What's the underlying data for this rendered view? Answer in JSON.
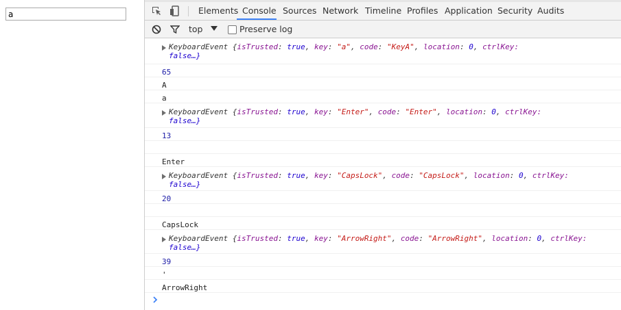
{
  "page": {
    "input_value": "a"
  },
  "tabs": [
    "Elements",
    "Console",
    "Sources",
    "Network",
    "Timeline",
    "Profiles",
    "Application",
    "Security",
    "Audits"
  ],
  "active_tab": "Console",
  "toolbar": {
    "context": "top",
    "preserve_log": "Preserve log"
  },
  "console": {
    "ev1": {
      "name": "KeyboardEvent",
      "isTrusted": "true",
      "key": "\"a\"",
      "code": "\"KeyA\"",
      "location": "0",
      "ctrl": "ctrlKey:",
      "tail": "false…}"
    },
    "v1": "65",
    "v2": "A",
    "v3": "a",
    "ev2": {
      "name": "KeyboardEvent",
      "isTrusted": "true",
      "key": "\"Enter\"",
      "code": "\"Enter\"",
      "location": "0",
      "ctrl": "ctrlKey:",
      "tail": "false…}"
    },
    "v4": "13",
    "v5": "",
    "v6": "Enter",
    "ev3": {
      "name": "KeyboardEvent",
      "isTrusted": "true",
      "key": "\"CapsLock\"",
      "code": "\"CapsLock\"",
      "location": "0",
      "ctrl": "ctrlKey:",
      "tail": "false…}"
    },
    "v7": "20",
    "v8": "",
    "v9": "CapsLock",
    "ev4": {
      "name": "KeyboardEvent",
      "isTrusted": "true",
      "key": "\"ArrowRight\"",
      "code": "\"ArrowRight\"",
      "location": "0",
      "ctrl": "ctrlKey:",
      "tail": "false…}"
    },
    "v10": "39",
    "v11": "'",
    "v12": "ArrowRight"
  },
  "colors": {
    "accent": "#3e82f7",
    "number": "#1a1aa6",
    "key": "#881391",
    "string": "#c41a16"
  }
}
